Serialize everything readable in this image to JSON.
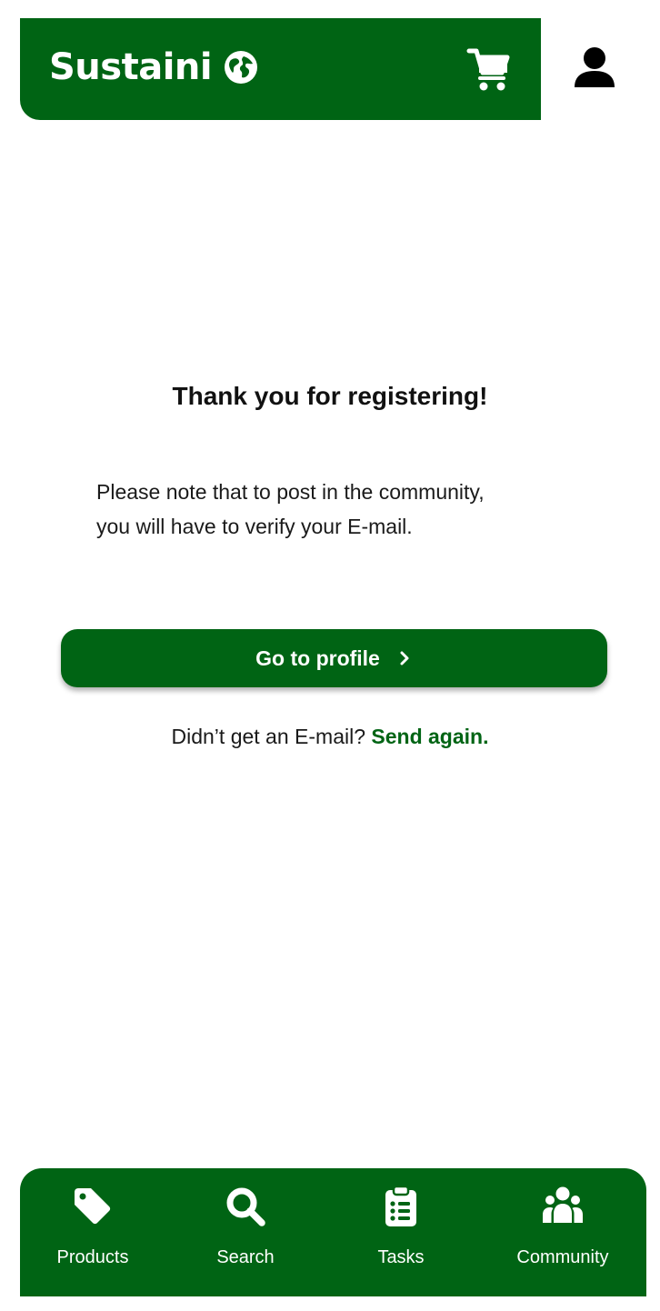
{
  "header": {
    "brand": "Sustaini",
    "icons": [
      "globe-icon",
      "cart-icon",
      "user-icon"
    ]
  },
  "main": {
    "title": "Thank you for registering!",
    "note_line1": "Please note that to post in the community,",
    "note_line2": "you will have to verify your E-mail.",
    "cta_label": "Go to profile",
    "resend_text": "Didn’t get an E-mail?",
    "resend_link": "Send again."
  },
  "nav": {
    "items": [
      {
        "label": "Products",
        "icon": "tag-icon"
      },
      {
        "label": "Search",
        "icon": "search-icon"
      },
      {
        "label": "Tasks",
        "icon": "clipboard-icon"
      },
      {
        "label": "Community",
        "icon": "people-icon"
      }
    ]
  },
  "colors": {
    "brand_green": "#006414",
    "text": "#111111",
    "background": "#ffffff"
  }
}
